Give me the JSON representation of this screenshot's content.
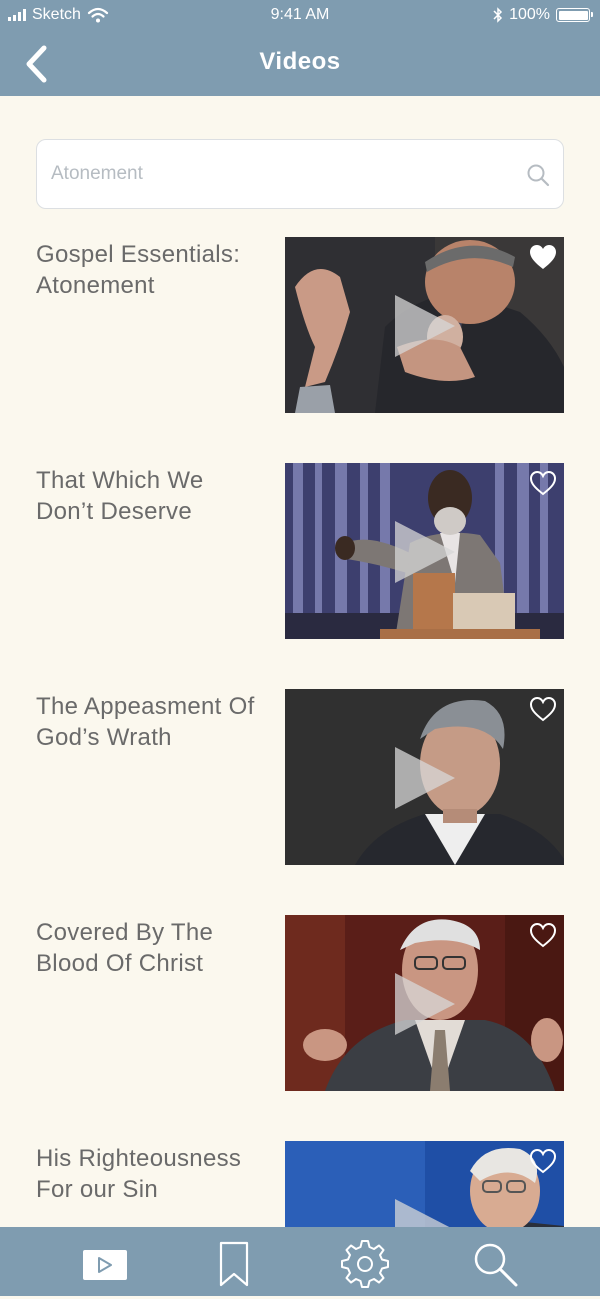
{
  "status_bar": {
    "carrier": "Sketch",
    "time": "9:41 AM",
    "battery": "100%",
    "icons": [
      "signal-icon",
      "wifi-icon",
      "bluetooth-icon",
      "battery-icon"
    ]
  },
  "nav": {
    "title": "Videos",
    "back_icon": "chevron-left-icon"
  },
  "search": {
    "placeholder": "Atonement",
    "icon": "search-icon"
  },
  "videos": [
    {
      "title": "Gospel Essentials: Atonement",
      "favorited": true
    },
    {
      "title": "That Which We Don’t Deserve",
      "favorited": false
    },
    {
      "title": "The Appeasment Of God’s Wrath",
      "favorited": false
    },
    {
      "title": "Covered By The Blood Of Christ",
      "favorited": false
    },
    {
      "title": "His Righteousness For our Sin",
      "favorited": false
    }
  ],
  "tab_bar": {
    "tabs": [
      "videos-tab",
      "bookmarks-tab",
      "settings-tab",
      "search-tab"
    ],
    "active": "videos-tab"
  },
  "colors": {
    "bar": "#7f9cb0",
    "background": "#fbf8ee",
    "title_text": "#6a6a6a"
  }
}
